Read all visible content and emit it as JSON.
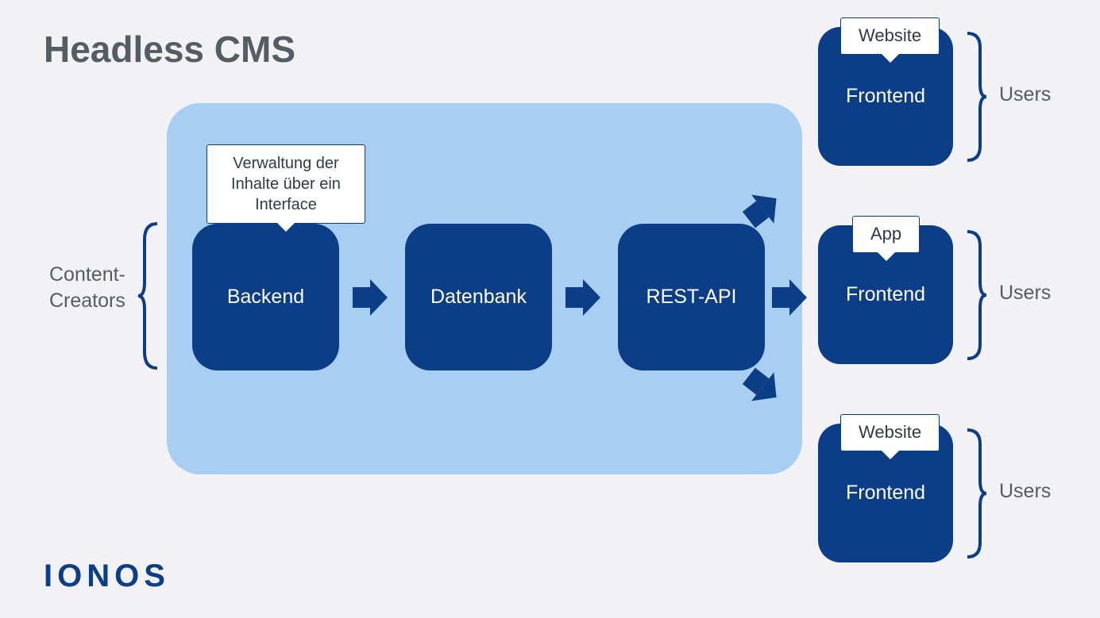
{
  "title": "Headless CMS",
  "brand": "IONOS",
  "left_label_line1": "Content-",
  "left_label_line2": "Creators",
  "backend_callout": "Verwaltung der Inhalte über ein Interface",
  "boxes": {
    "backend": "Backend",
    "database": "Datenbank",
    "api": "REST-API"
  },
  "outputs": [
    {
      "callout": "Website",
      "box": "Frontend",
      "side": "Users"
    },
    {
      "callout": "App",
      "box": "Frontend",
      "side": "Users"
    },
    {
      "callout": "Website",
      "box": "Frontend",
      "side": "Users"
    }
  ]
}
